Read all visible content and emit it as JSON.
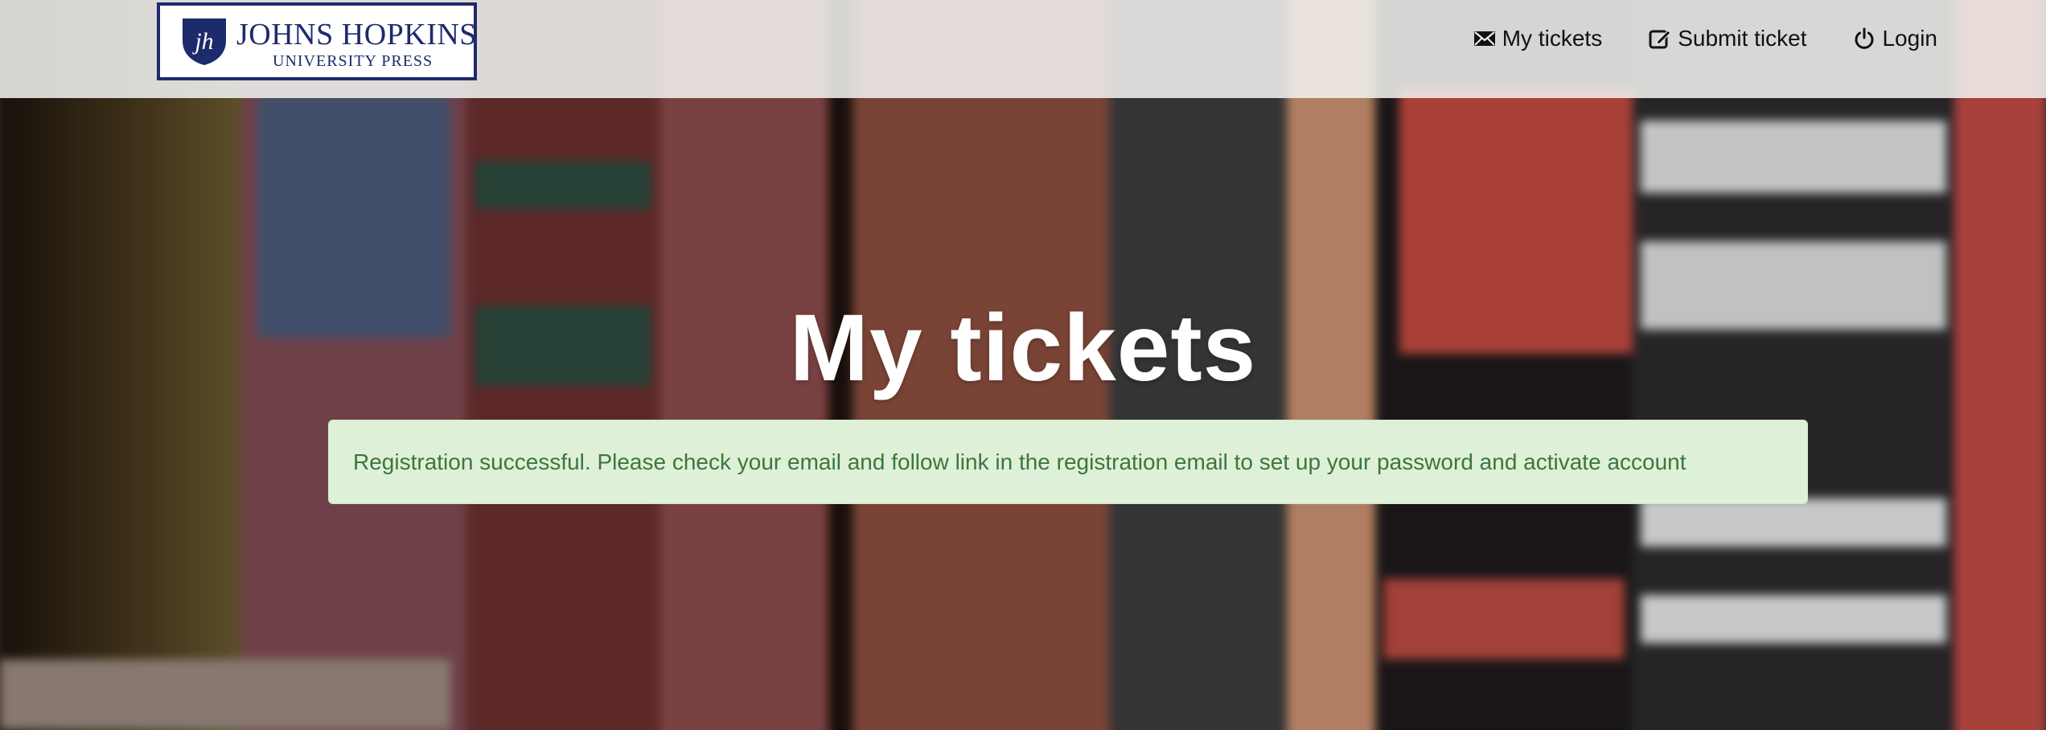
{
  "header": {
    "logo": {
      "line1": "JOHNS HOPKINS",
      "line2": "UNIVERSITY PRESS",
      "monogram": "jh"
    },
    "nav": [
      {
        "label": "My tickets",
        "icon": "envelope-icon"
      },
      {
        "label": "Submit ticket",
        "icon": "edit-icon"
      },
      {
        "label": "Login",
        "icon": "power-icon"
      }
    ]
  },
  "main": {
    "title": "My tickets",
    "alert": {
      "text": "Registration successful. Please check your email and follow link in the registration email to set up your password and activate account"
    }
  },
  "colors": {
    "brand_navy": "#1d2a6b",
    "alert_bg": "#dff0d8",
    "alert_text": "#3c763d",
    "header_bg": "#f0f0ee"
  }
}
